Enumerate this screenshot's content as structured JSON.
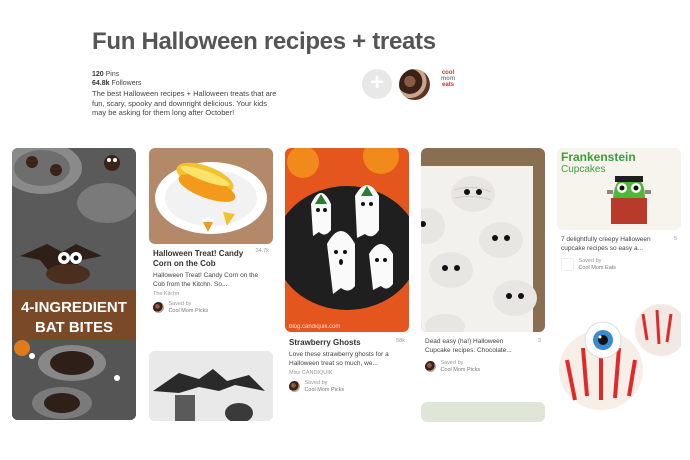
{
  "board": {
    "title": "Fun Halloween recipes + treats",
    "pins_count": "120",
    "pins_label": "Pins",
    "followers_count": "64.8k",
    "followers_label": "Followers",
    "description": "The best Halloween recipes + Halloween treats that are fun, scary, spooky and downright delicious. Your kids may be asking for them long after October!",
    "add_label": "+",
    "owner_logo_lines": [
      "cool",
      "mom",
      "eats"
    ]
  },
  "pins": [
    {
      "image_text": [
        "4-INGREDIENT",
        "BAT BITES"
      ]
    },
    {
      "title": "Halloween Treat! Candy Corn on the Cob",
      "count": "34.7k",
      "description": "Halloween Treat! Candy Corn on the Cob from the Kitchn. So...",
      "source": "The Kitchn",
      "saved_by": "Saved by",
      "saver": "Cool Mom Picks"
    },
    {
      "title": "Strawberry Ghosts",
      "count": "58k",
      "description": "Love these strawberry ghosts for a Halloween treat so much, we...",
      "source": "Miss CANDIQUIK",
      "saved_by": "Saved by",
      "saver": "Cool Mom Picks",
      "watermark": "blog.candiquik.com"
    },
    {
      "title": "Dead easy (ha!) Halloween Cupcake recipes: Chocolate...",
      "count": "3",
      "saved_by": "Saved by",
      "saver": "Cool Mom Picks"
    },
    {
      "image_text": [
        "Frankenstein",
        "Cupcakes"
      ],
      "title": "7 delightfully creepy Halloween cupcake recipes so easy a...",
      "count": "5",
      "saved_by": "Saved by",
      "saver": "Cool Mom Eats"
    }
  ]
}
